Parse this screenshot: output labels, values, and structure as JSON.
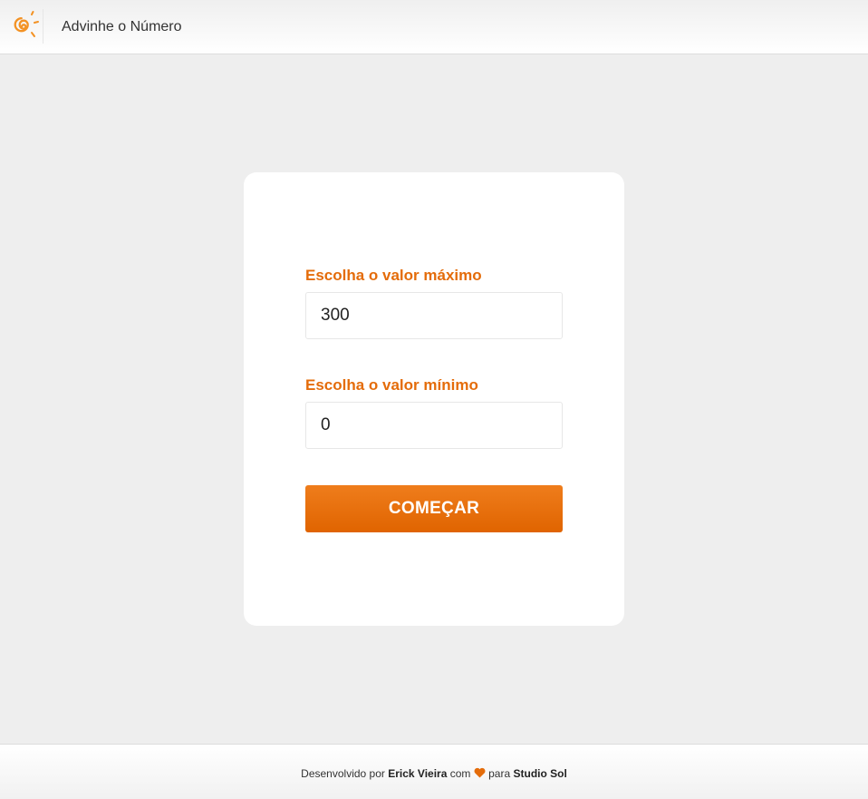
{
  "header": {
    "title": "Advinhe o Número",
    "logo_icon": "sun-spiral-logo-icon"
  },
  "form": {
    "max_label": "Escolha o valor máximo",
    "max_value": "300",
    "min_label": "Escolha o valor mínimo",
    "min_value": "0",
    "start_button_label": "COMEÇAR"
  },
  "footer": {
    "prefix": "Desenvolvido por",
    "author": "Erick Vieira",
    "middle": "com",
    "heart_icon": "heart-icon",
    "connector": "para",
    "company": "Studio Sol"
  },
  "colors": {
    "accent": "#e46c0a",
    "button": "#e66a02",
    "background": "#eeeeee",
    "card": "#ffffff"
  }
}
